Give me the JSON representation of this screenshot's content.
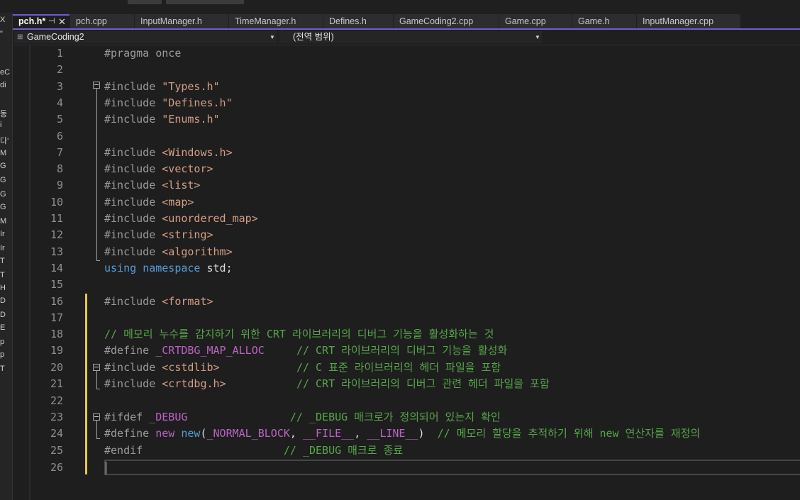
{
  "tabs": [
    {
      "label": "pch.h*",
      "active": true
    },
    {
      "label": "pch.cpp"
    },
    {
      "label": "InputManager.h"
    },
    {
      "label": "TimeManager.h"
    },
    {
      "label": "Defines.h"
    },
    {
      "label": "GameCoding2.cpp"
    },
    {
      "label": "Game.cpp"
    },
    {
      "label": "Game.h"
    },
    {
      "label": "InputManager.cpp"
    }
  ],
  "tab_pin": "⊣",
  "tab_close": "✕",
  "nav": {
    "project": "GameCoding2",
    "scope": "(전역 범위)"
  },
  "left_panel_fragments": [
    "X",
    "\"",
    "eC",
    "di",
    "동",
    "i",
    "다'",
    "M",
    "G",
    "G",
    "G",
    "G",
    "M",
    "Ir",
    "Ir",
    "T",
    "T",
    "H",
    "D",
    "D",
    "E",
    "p",
    "p",
    "T"
  ],
  "line_numbers": [
    "1",
    "2",
    "3",
    "4",
    "5",
    "6",
    "7",
    "8",
    "9",
    "10",
    "11",
    "12",
    "13",
    "14",
    "15",
    "16",
    "17",
    "18",
    "19",
    "20",
    "21",
    "22",
    "23",
    "24",
    "25",
    "26"
  ],
  "code": {
    "l1": {
      "a": "#pragma once"
    },
    "l3": {
      "a": "#include ",
      "b": "\"Types.h\""
    },
    "l4": {
      "a": "#include ",
      "b": "\"Defines.h\""
    },
    "l5": {
      "a": "#include ",
      "b": "\"Enums.h\""
    },
    "l7": {
      "a": "#include ",
      "b": "<Windows.h>"
    },
    "l8": {
      "a": "#include ",
      "b": "<vector>"
    },
    "l9": {
      "a": "#include ",
      "b": "<list>"
    },
    "l10": {
      "a": "#include ",
      "b": "<map>"
    },
    "l11": {
      "a": "#include ",
      "b": "<unordered_map>"
    },
    "l12": {
      "a": "#include ",
      "b": "<string>"
    },
    "l13": {
      "a": "#include ",
      "b": "<algorithm>"
    },
    "l14": {
      "a": "using",
      "b": " ",
      "c": "namespace",
      "d": " std;"
    },
    "l16": {
      "a": "#include ",
      "b": "<format>"
    },
    "l18": {
      "a": "// 메모리 누수를 감지하기 위한 CRT 라이브러리의 디버그 기능을 활성화하는 것"
    },
    "l19": {
      "a": "#define ",
      "b": "_CRTDBG_MAP_ALLOC",
      "c": "     ",
      "d": "// CRT 라이브러리의 디버그 기능을 활성화"
    },
    "l20": {
      "a": "#include ",
      "b": "<cstdlib>",
      "c": "            ",
      "d": "// C 표준 라이브러리의 헤더 파일을 포함"
    },
    "l21": {
      "a": "#include ",
      "b": "<crtdbg.h>",
      "c": "           ",
      "d": "// CRT 라이브러리의 디버그 관련 헤더 파일을 포함"
    },
    "l23": {
      "a": "#ifdef ",
      "b": "_DEBUG",
      "c": "                ",
      "d": "// _DEBUG 매크로가 정의되어 있는지 확인"
    },
    "l24": {
      "a": "#define ",
      "b": "new",
      "c": " ",
      "d": "new",
      "e": "(",
      "f": "_NORMAL_BLOCK",
      "g": ", ",
      "h": "__FILE__",
      "i": ", ",
      "j": "__LINE__",
      "k": ")  ",
      "l": "// 메모리 할당을 추적하기 위해 new 연산자를 재정의"
    },
    "l25": {
      "a": "#endif",
      "b": "                      ",
      "c": "// _DEBUG 매크로 종료"
    }
  },
  "colors": {
    "accent": "#6b5fd3",
    "preprocessor": "#9b9b9b",
    "string": "#d69d85",
    "keyword": "#569cd6",
    "comment": "#57a64a",
    "macro": "#bd63c5",
    "change_marker": "#e6c840"
  }
}
